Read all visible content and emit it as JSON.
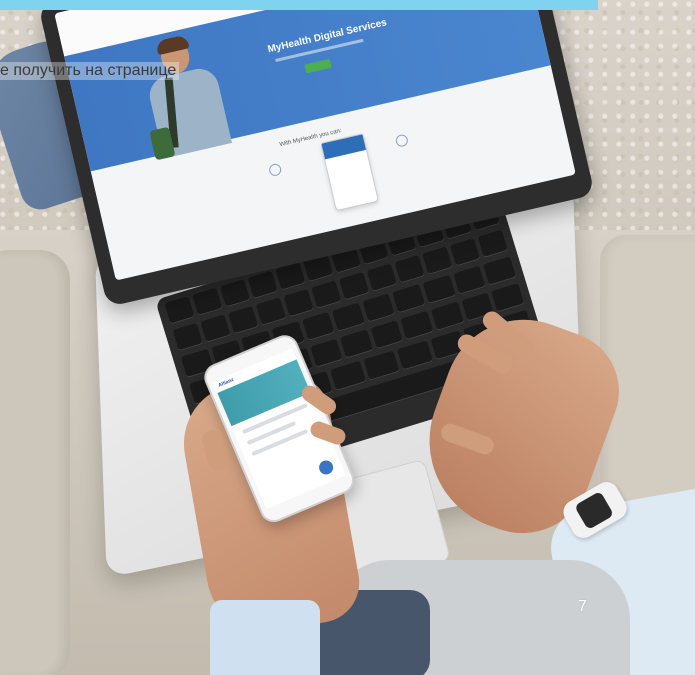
{
  "caption": "е получить на странице",
  "page_number": "7",
  "laptop_site": {
    "hero_title": "MyHealth Digital Services",
    "section_title": "With MyHealth you can:"
  },
  "colors": {
    "banner": "#7fd3ef",
    "hero_blue": "#3f77c2",
    "cta_green": "#4caf50",
    "phone_hero": "#3f9cab"
  }
}
